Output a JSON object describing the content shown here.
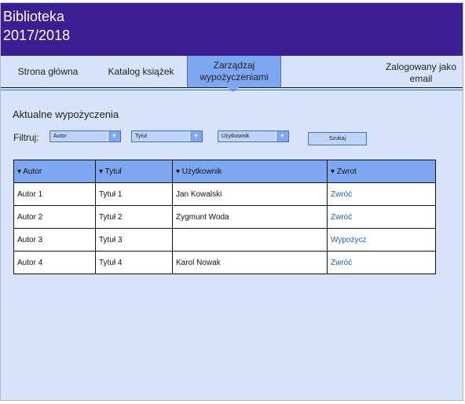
{
  "app": {
    "title": "Biblioteka\n2017/2018"
  },
  "nav": {
    "items": [
      {
        "label": "Strona główna"
      },
      {
        "label": "Katalog książek"
      },
      {
        "label": "Zarządzaj wypożyczeniami"
      },
      {
        "label": "Zalogowany jako email"
      }
    ]
  },
  "main": {
    "section_title": "Aktualne wypożyczenia",
    "filter_label": "Filtruj:",
    "filters": [
      {
        "value": "Autor"
      },
      {
        "value": "Tytuł"
      },
      {
        "value": "Użytkownik"
      }
    ],
    "search_label": "Szukaj",
    "columns": [
      "▾ Autor",
      "▾ Tytuł",
      "▾ Użytkownik",
      "▾ Zwrot"
    ],
    "rows": [
      {
        "autor": "Autor 1",
        "tytul": "Tytuł 1",
        "uzytkownik": "Jan Kowalski",
        "zwrot": "Zwróć"
      },
      {
        "autor": "Autor 2",
        "tytul": "Tytuł 2",
        "uzytkownik": "Zygmunt Woda",
        "zwrot": "Zwróć"
      },
      {
        "autor": "Autor 3",
        "tytul": "Tytuł 3",
        "uzytkownik": "",
        "zwrot": "Wypożycz"
      },
      {
        "autor": "Autor 4",
        "tytul": "Tytuł 4",
        "uzytkownik": "Karol Nowak",
        "zwrot": "Zwróć"
      }
    ]
  },
  "colors": {
    "header": "#3b1f92",
    "accent": "#7ea7f2",
    "background": "#d6e3f8",
    "link": "#1a5fc8"
  },
  "icons": {
    "dropdown": "chevron-down-icon",
    "sort": "sort-down-icon"
  }
}
